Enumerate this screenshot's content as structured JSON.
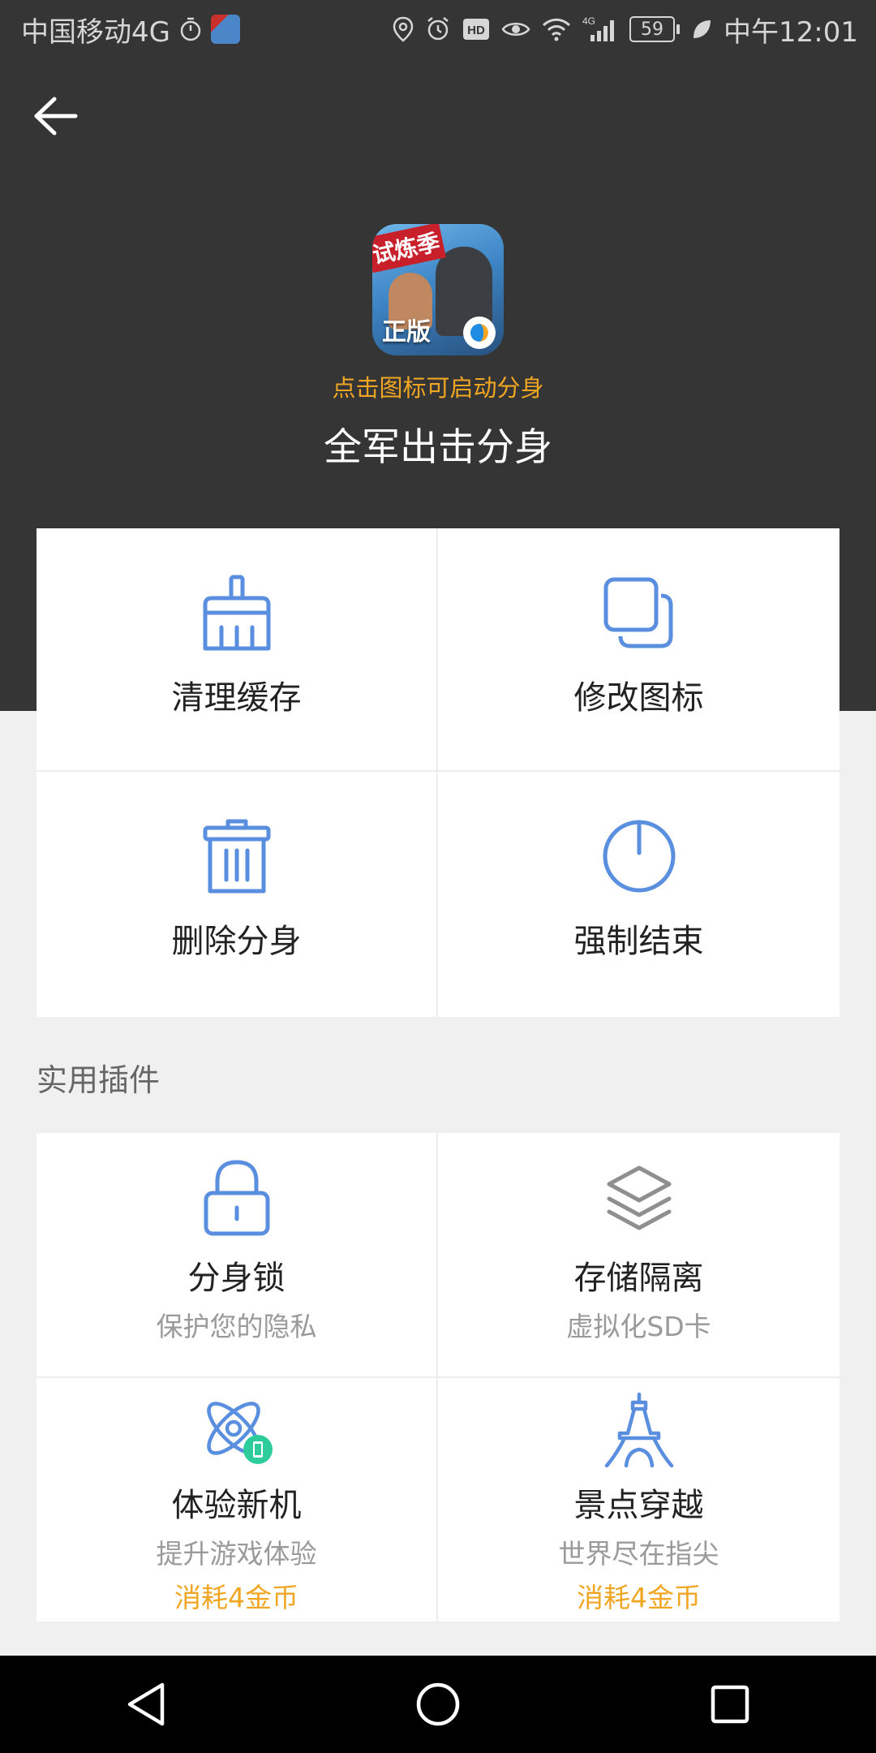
{
  "status_bar": {
    "carrier": "中国移动4G",
    "battery": "59",
    "time": "中午12:01",
    "network_label": "4G"
  },
  "header": {
    "hint": "点击图标可启动分身",
    "title": "全军出击分身",
    "app_icon": {
      "badge_top": "试炼季",
      "badge_bottom": "正版"
    }
  },
  "actions": [
    {
      "label": "清理缓存",
      "icon": "broom-icon"
    },
    {
      "label": "修改图标",
      "icon": "copy-icon"
    },
    {
      "label": "删除分身",
      "icon": "trash-icon"
    },
    {
      "label": "强制结束",
      "icon": "power-icon"
    }
  ],
  "plugins_section": {
    "title": "实用插件",
    "items": [
      {
        "label": "分身锁",
        "sub": "保护您的隐私",
        "icon": "lock-icon"
      },
      {
        "label": "存储隔离",
        "sub": "虚拟化SD卡",
        "icon": "layers-icon"
      },
      {
        "label": "体验新机",
        "sub": "提升游戏体验",
        "cost": "消耗4金币",
        "icon": "atom-phone-icon"
      },
      {
        "label": "景点穿越",
        "sub": "世界尽在指尖",
        "cost": "消耗4金币",
        "icon": "eiffel-tower-icon"
      }
    ]
  },
  "colors": {
    "accent": "#5a8fe0",
    "orange": "#f0a623",
    "header_bg": "#353535",
    "page_bg": "#f0f0f0",
    "green": "#2ecc9a"
  }
}
